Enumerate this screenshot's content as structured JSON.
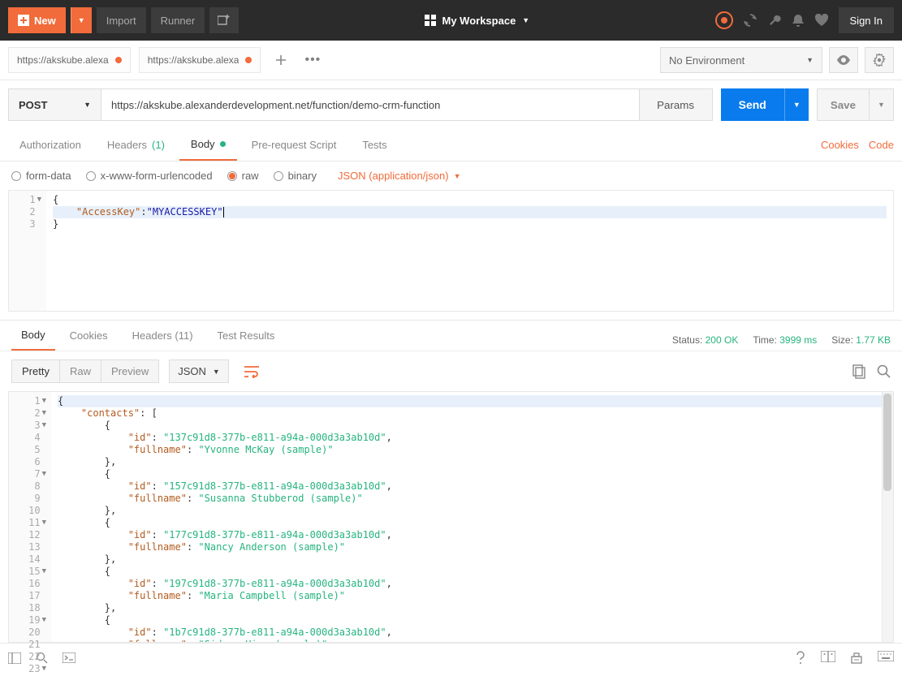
{
  "header": {
    "new_label": "New",
    "import_label": "Import",
    "runner_label": "Runner",
    "workspace_label": "My Workspace",
    "signin_label": "Sign In"
  },
  "tabs": [
    {
      "title": "https://akskube.alexa"
    },
    {
      "title": "https://akskube.alexa"
    }
  ],
  "env": {
    "selected": "No Environment"
  },
  "request": {
    "method": "POST",
    "url": "https://akskube.alexanderdevelopment.net/function/demo-crm-function",
    "params_label": "Params",
    "send_label": "Send",
    "save_label": "Save"
  },
  "req_tabs": {
    "auth": "Authorization",
    "headers": "Headers",
    "headers_count": "(1)",
    "body": "Body",
    "prereq": "Pre-request Script",
    "tests": "Tests",
    "cookies_link": "Cookies",
    "code_link": "Code"
  },
  "body_radios": {
    "formdata": "form-data",
    "urlenc": "x-www-form-urlencoded",
    "raw": "raw",
    "binary": "binary",
    "content_type": "JSON (application/json)"
  },
  "req_body": {
    "lines": [
      {
        "n": 1,
        "fold": true,
        "raw": "{"
      },
      {
        "n": 2,
        "fold": false,
        "key": "\"AccessKey\"",
        "sep": ":",
        "val": "\"MYACCESSKEY\"",
        "hl": true,
        "cursor": true
      },
      {
        "n": 3,
        "fold": false,
        "raw": "}"
      }
    ]
  },
  "resp_tabs": {
    "body": "Body",
    "cookies": "Cookies",
    "headers": "Headers",
    "headers_count": "(11)",
    "tests": "Test Results"
  },
  "resp_stats": {
    "status_label": "Status:",
    "status_val": "200 OK",
    "time_label": "Time:",
    "time_val": "3999 ms",
    "size_label": "Size:",
    "size_val": "1.77 KB"
  },
  "resp_views": {
    "pretty": "Pretty",
    "raw": "Raw",
    "preview": "Preview",
    "format": "JSON"
  },
  "resp_body": [
    {
      "n": 1,
      "fold": true,
      "text": "{",
      "hl": true,
      "indent": 0
    },
    {
      "n": 2,
      "fold": true,
      "key": "\"contacts\"",
      "sep": ": [",
      "indent": 1
    },
    {
      "n": 3,
      "fold": true,
      "text": "{",
      "indent": 2
    },
    {
      "n": 4,
      "key": "\"id\"",
      "sep": ": ",
      "val": "\"137c91d8-377b-e811-a94a-000d3a3ab10d\"",
      "trail": ",",
      "indent": 3
    },
    {
      "n": 5,
      "key": "\"fullname\"",
      "sep": ": ",
      "val": "\"Yvonne McKay (sample)\"",
      "indent": 3
    },
    {
      "n": 6,
      "text": "},",
      "indent": 2
    },
    {
      "n": 7,
      "fold": true,
      "text": "{",
      "indent": 2
    },
    {
      "n": 8,
      "key": "\"id\"",
      "sep": ": ",
      "val": "\"157c91d8-377b-e811-a94a-000d3a3ab10d\"",
      "trail": ",",
      "indent": 3
    },
    {
      "n": 9,
      "key": "\"fullname\"",
      "sep": ": ",
      "val": "\"Susanna Stubberod (sample)\"",
      "indent": 3
    },
    {
      "n": 10,
      "text": "},",
      "indent": 2
    },
    {
      "n": 11,
      "fold": true,
      "text": "{",
      "indent": 2
    },
    {
      "n": 12,
      "key": "\"id\"",
      "sep": ": ",
      "val": "\"177c91d8-377b-e811-a94a-000d3a3ab10d\"",
      "trail": ",",
      "indent": 3
    },
    {
      "n": 13,
      "key": "\"fullname\"",
      "sep": ": ",
      "val": "\"Nancy Anderson (sample)\"",
      "indent": 3
    },
    {
      "n": 14,
      "text": "},",
      "indent": 2
    },
    {
      "n": 15,
      "fold": true,
      "text": "{",
      "indent": 2
    },
    {
      "n": 16,
      "key": "\"id\"",
      "sep": ": ",
      "val": "\"197c91d8-377b-e811-a94a-000d3a3ab10d\"",
      "trail": ",",
      "indent": 3
    },
    {
      "n": 17,
      "key": "\"fullname\"",
      "sep": ": ",
      "val": "\"Maria Campbell (sample)\"",
      "indent": 3
    },
    {
      "n": 18,
      "text": "},",
      "indent": 2
    },
    {
      "n": 19,
      "fold": true,
      "text": "{",
      "indent": 2
    },
    {
      "n": 20,
      "key": "\"id\"",
      "sep": ": ",
      "val": "\"1b7c91d8-377b-e811-a94a-000d3a3ab10d\"",
      "trail": ",",
      "indent": 3
    },
    {
      "n": 21,
      "key": "\"fullname\"",
      "sep": ": ",
      "val": "\"Sidney Higa (sample)\"",
      "indent": 3
    },
    {
      "n": 22,
      "text": "},",
      "indent": 2
    },
    {
      "n": 23,
      "fold": true,
      "text": "{",
      "indent": 2
    }
  ]
}
